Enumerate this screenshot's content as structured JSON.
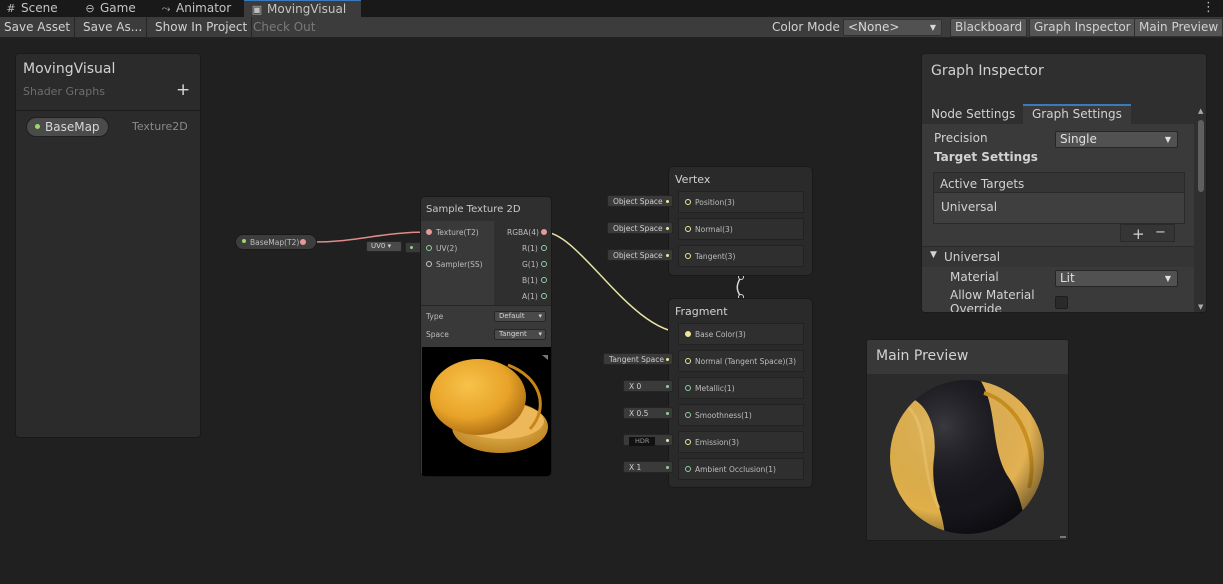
{
  "tabs": [
    {
      "icon": "grid-icon",
      "glyph": "#",
      "label": "Scene"
    },
    {
      "icon": "gamepad-icon",
      "glyph": "⊖",
      "label": "Game"
    },
    {
      "icon": "animator-icon",
      "glyph": "⤳",
      "label": "Animator"
    },
    {
      "icon": "shader-graph-icon",
      "glyph": "▣",
      "label": "MovingVisual"
    }
  ],
  "toolbar": {
    "save_asset": "Save Asset",
    "save_as": "Save As...",
    "show_in_project": "Show In Project",
    "check_out": "Check Out",
    "color_mode_label": "Color Mode",
    "color_mode_value": "<None>",
    "blackboard": "Blackboard",
    "graph_inspector": "Graph Inspector",
    "main_preview": "Main Preview"
  },
  "blackboard": {
    "title": "MovingVisual",
    "subtitle": "Shader Graphs",
    "add": "+",
    "property": {
      "name": "BaseMap",
      "type": "Texture2D"
    }
  },
  "graph": {
    "basemap_node": "BaseMap(T2)",
    "uv_dropdown": "UV0",
    "sample_node": {
      "title": "Sample Texture 2D",
      "inputs": [
        "Texture(T2)",
        "UV(2)",
        "Sampler(SS)"
      ],
      "outputs": [
        "RGBA(4)",
        "R(1)",
        "G(1)",
        "B(1)",
        "A(1)"
      ],
      "type_label": "Type",
      "type_value": "Default",
      "space_label": "Space",
      "space_value": "Tangent"
    },
    "vertex": {
      "title": "Vertex",
      "slots": [
        {
          "input": "Object Space",
          "label": "Position(3)"
        },
        {
          "input": "Object Space",
          "label": "Normal(3)"
        },
        {
          "input": "Object Space",
          "label": "Tangent(3)"
        }
      ]
    },
    "fragment": {
      "title": "Fragment",
      "slots": [
        {
          "input": "",
          "label": "Base Color(3)"
        },
        {
          "input": "Tangent Space",
          "label": "Normal (Tangent Space)(3)"
        },
        {
          "input": "X  0",
          "label": "Metallic(1)"
        },
        {
          "input": "X  0.5",
          "label": "Smoothness(1)"
        },
        {
          "input": "HDR",
          "label": "Emission(3)"
        },
        {
          "input": "X  1",
          "label": "Ambient Occlusion(1)"
        }
      ]
    }
  },
  "inspector": {
    "title": "Graph Inspector",
    "tab_node": "Node Settings",
    "tab_graph": "Graph Settings",
    "precision_label": "Precision",
    "precision_value": "Single",
    "target_settings": "Target Settings",
    "active_targets": "Active Targets",
    "target_item": "Universal",
    "plus": "+",
    "minus": "−",
    "section": "Universal",
    "material_label": "Material",
    "material_value": "Lit",
    "allow_override": "Allow Material",
    "allow_override_2": "Override"
  },
  "preview": {
    "title": "Main Preview"
  },
  "colors": {
    "accent": "#3a79bb",
    "edge_texture": "#e08a8a",
    "edge_vector": "#e8e3a4",
    "edge_uv": "#8ed1a1"
  }
}
